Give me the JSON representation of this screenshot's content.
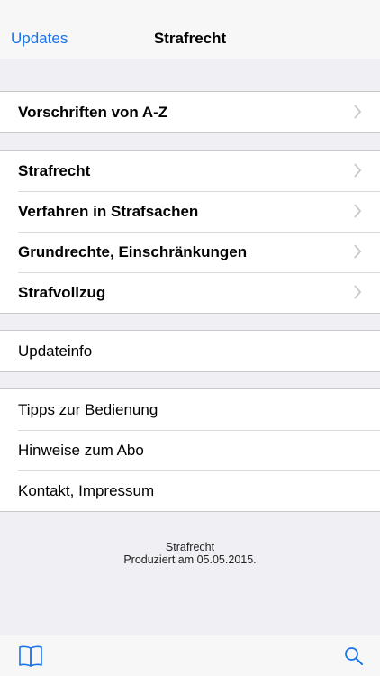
{
  "navbar": {
    "back_label": "Updates",
    "title": "Strafrecht"
  },
  "groups": [
    {
      "items": [
        {
          "label": "Vorschriften von A-Z",
          "chevron": true
        }
      ]
    },
    {
      "items": [
        {
          "label": "Strafrecht",
          "chevron": true
        },
        {
          "label": "Verfahren in Strafsachen",
          "chevron": true
        },
        {
          "label": "Grundrechte, Einschränkungen",
          "chevron": true
        },
        {
          "label": "Strafvollzug",
          "chevron": true
        }
      ]
    },
    {
      "items": [
        {
          "label": "Updateinfo",
          "chevron": false
        }
      ]
    },
    {
      "items": [
        {
          "label": "Tipps zur Bedienung",
          "chevron": false
        },
        {
          "label": "Hinweise zum Abo",
          "chevron": false
        },
        {
          "label": "Kontakt, Impressum",
          "chevron": false
        }
      ]
    }
  ],
  "footer": {
    "line1": "Strafrecht",
    "line2": "Produziert am 05.05.2015."
  },
  "tabbar": {
    "left_icon": "book-icon",
    "right_icon": "search-icon"
  },
  "colors": {
    "accent": "#1a73e8",
    "background": "#efeff4",
    "chevron": "#c7c7cc"
  }
}
